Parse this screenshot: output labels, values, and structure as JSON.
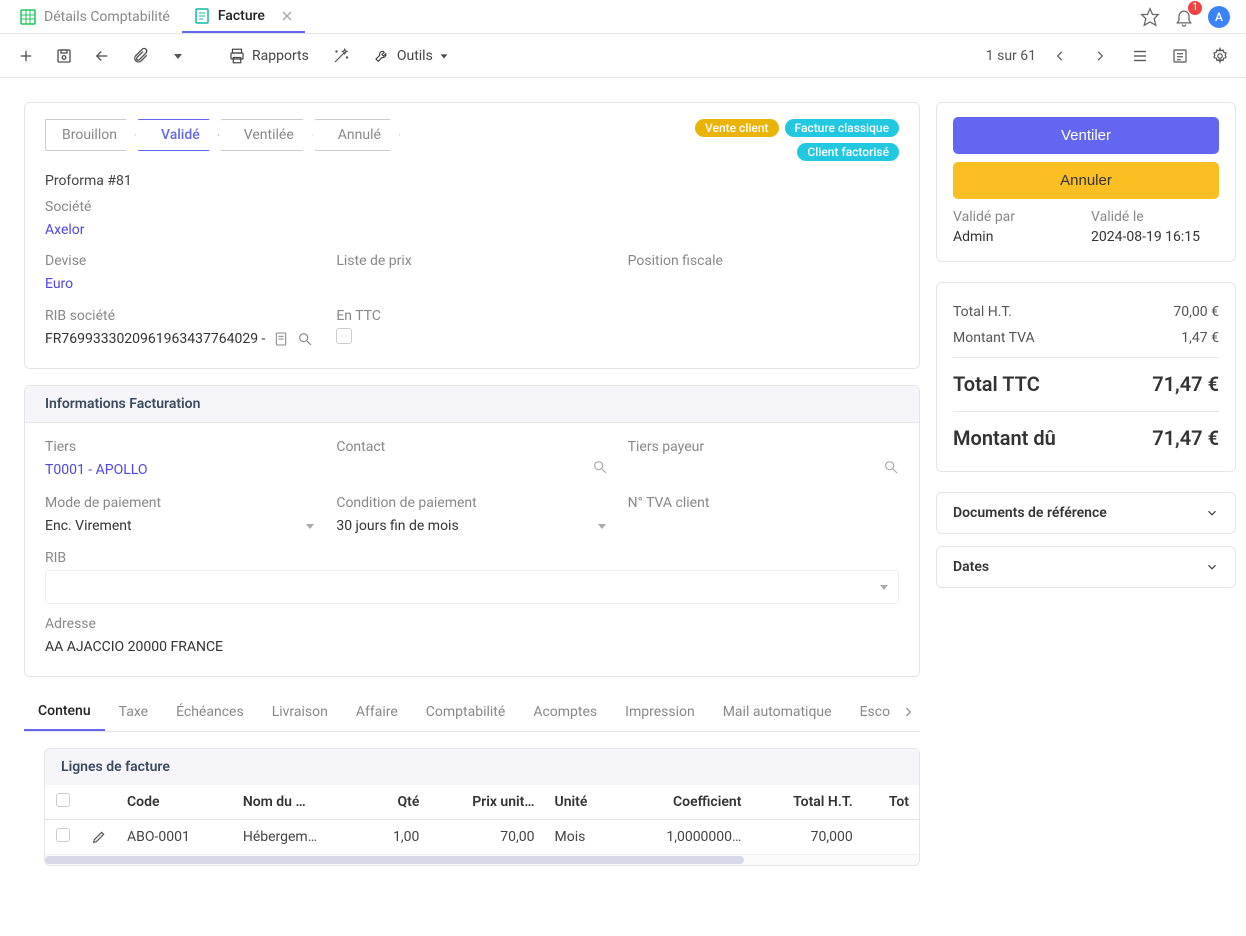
{
  "tabs": [
    {
      "icon": "spreadsheet-green",
      "label": "Détails Comptabilité"
    },
    {
      "icon": "doc-teal",
      "label": "Facture",
      "active": true,
      "closable": true
    }
  ],
  "notifications": {
    "count": "1"
  },
  "avatar_letter": "A",
  "toolbar": {
    "reports_label": "Rapports",
    "tools_label": "Outils",
    "pager": "1 sur 61"
  },
  "status_steps": [
    "Brouillon",
    "Validé",
    "Ventilée",
    "Annulé"
  ],
  "status_active_index": 1,
  "badges": [
    {
      "text": "Vente client",
      "color": "amber"
    },
    {
      "text": "Facture classique",
      "color": "cyan"
    },
    {
      "text": "Client factorisé",
      "color": "cyan"
    }
  ],
  "proforma_text": "Proforma #81",
  "fields_top": {
    "societe_label": "Société",
    "societe_value": "Axelor",
    "devise_label": "Devise",
    "devise_value": "Euro",
    "liste_prix_label": "Liste de prix",
    "liste_prix_value": "",
    "position_fiscale_label": "Position fiscale",
    "position_fiscale_value": "",
    "rib_societe_label": "RIB société",
    "rib_societe_value": "FR7699333020961963437764029 -",
    "en_ttc_label": "En TTC"
  },
  "billing_header": "Informations Facturation",
  "billing": {
    "tiers_label": "Tiers",
    "tiers_value": "T0001 - APOLLO",
    "contact_label": "Contact",
    "tiers_payeur_label": "Tiers payeur",
    "mode_paiement_label": "Mode de paiement",
    "mode_paiement_value": "Enc. Virement",
    "condition_label": "Condition de paiement",
    "condition_value": "30 jours fin de mois",
    "tva_client_label": "N° TVA client",
    "rib_label": "RIB",
    "adresse_label": "Adresse",
    "adresse_value": "AA AJACCIO 20000 FRANCE"
  },
  "subtabs": [
    "Contenu",
    "Taxe",
    "Échéances",
    "Livraison",
    "Affaire",
    "Comptabilité",
    "Acomptes",
    "Impression",
    "Mail automatique",
    "Esco"
  ],
  "subtab_active_index": 0,
  "lines": {
    "header": "Lignes de facture",
    "columns": [
      "Code",
      "Nom du …",
      "Qté",
      "Prix unit…",
      "Unité",
      "Coefficient",
      "Total H.T.",
      "Tot"
    ],
    "rows": [
      {
        "code": "ABO-0001",
        "name": "Hébergem…",
        "qty": "1,00",
        "unit_price": "70,00",
        "unit": "Mois",
        "coef": "1,0000000…",
        "total_ht": "70,000"
      }
    ]
  },
  "actions": {
    "ventiler_label": "Ventiler",
    "annuler_label": "Annuler",
    "valide_par_label": "Validé par",
    "valide_le_label": "Validé le",
    "valide_par_value": "Admin",
    "valide_le_value": "2024-08-19 16:15"
  },
  "totals": {
    "total_ht_label": "Total H.T.",
    "total_ht_value": "70,00 €",
    "tva_label": "Montant TVA",
    "tva_value": "1,47 €",
    "total_ttc_label": "Total TTC",
    "total_ttc_value": "71,47 €",
    "due_label": "Montant dû",
    "due_value": "71,47 €"
  },
  "collapsibles": {
    "docs_ref": "Documents de référence",
    "dates": "Dates"
  }
}
